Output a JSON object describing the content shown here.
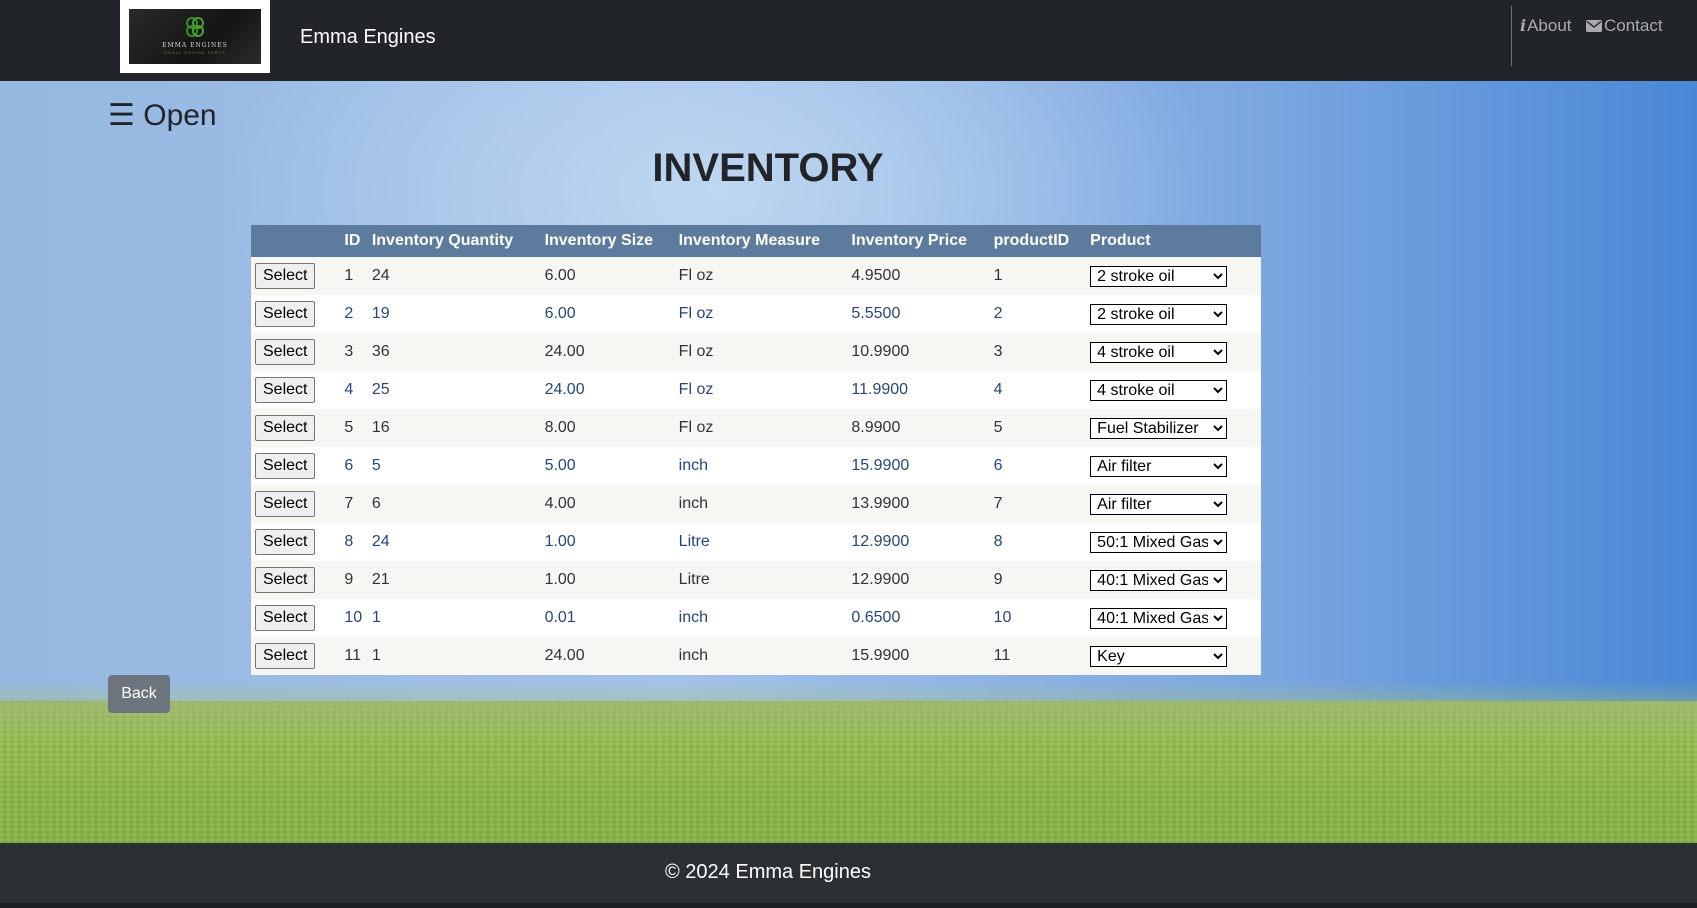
{
  "header": {
    "logo_text": "EMMA ENGINES",
    "logo_subtext": "SMALL ENGINE PARTS",
    "brand": "Emma Engines",
    "nav": [
      {
        "label": "About",
        "icon": "info-icon"
      },
      {
        "label": "Contact",
        "icon": "envelope-icon"
      }
    ]
  },
  "sidebar_toggle": "☰ Open",
  "page_title": "INVENTORY",
  "table": {
    "columns": [
      "",
      "ID",
      "Inventory Quantity",
      "Inventory Size",
      "Inventory Measure",
      "Inventory Price",
      "productID",
      "Product"
    ],
    "select_label": "Select",
    "rows": [
      {
        "id": "1",
        "qty": "24",
        "size": "6.00",
        "measure": "Fl oz",
        "price": "4.9500",
        "product_id": "1",
        "product": "2 stroke oil"
      },
      {
        "id": "2",
        "qty": "19",
        "size": "6.00",
        "measure": "Fl oz",
        "price": "5.5500",
        "product_id": "2",
        "product": "2 stroke oil"
      },
      {
        "id": "3",
        "qty": "36",
        "size": "24.00",
        "measure": "Fl oz",
        "price": "10.9900",
        "product_id": "3",
        "product": "4 stroke oil"
      },
      {
        "id": "4",
        "qty": "25",
        "size": "24.00",
        "measure": "Fl oz",
        "price": "11.9900",
        "product_id": "4",
        "product": "4 stroke oil"
      },
      {
        "id": "5",
        "qty": "16",
        "size": "8.00",
        "measure": "Fl oz",
        "price": "8.9900",
        "product_id": "5",
        "product": "Fuel Stabilizer"
      },
      {
        "id": "6",
        "qty": "5",
        "size": "5.00",
        "measure": "inch",
        "price": "15.9900",
        "product_id": "6",
        "product": "Air filter"
      },
      {
        "id": "7",
        "qty": "6",
        "size": "4.00",
        "measure": "inch",
        "price": "13.9900",
        "product_id": "7",
        "product": "Air filter"
      },
      {
        "id": "8",
        "qty": "24",
        "size": "1.00",
        "measure": "Litre",
        "price": "12.9900",
        "product_id": "8",
        "product": "50:1 Mixed Gas"
      },
      {
        "id": "9",
        "qty": "21",
        "size": "1.00",
        "measure": "Litre",
        "price": "12.9900",
        "product_id": "9",
        "product": "40:1 Mixed Gas"
      },
      {
        "id": "10",
        "qty": "1",
        "size": "0.01",
        "measure": "inch",
        "price": "0.6500",
        "product_id": "10",
        "product": "40:1 Mixed Gas"
      },
      {
        "id": "11",
        "qty": "1",
        "size": "24.00",
        "measure": "inch",
        "price": "15.9900",
        "product_id": "11",
        "product": "Key"
      }
    ]
  },
  "back_label": "Back",
  "footer_text": "© 2024 Emma Engines",
  "colors": {
    "navbar": "#212529",
    "table_header": "#5d7b9d",
    "row_odd": "#f7f6f3",
    "row_even": "#ffffff",
    "back_button": "#6c757d",
    "footer": "#2b3035"
  }
}
